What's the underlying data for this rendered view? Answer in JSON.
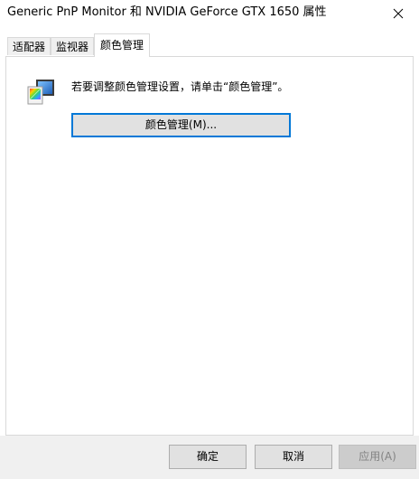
{
  "window": {
    "title": "Generic PnP Monitor 和 NVIDIA GeForce GTX 1650 属性"
  },
  "tabs": [
    {
      "label": "适配器",
      "active": false
    },
    {
      "label": "监视器",
      "active": false
    },
    {
      "label": "颜色管理",
      "active": true
    }
  ],
  "color_management": {
    "instruction": "若要调整颜色管理设置，请单击“颜色管理”。",
    "button_label": "颜色管理(M)...",
    "icon": "monitor-color-icon"
  },
  "footer": {
    "ok_label": "确定",
    "cancel_label": "取消",
    "apply_label": "应用(A)",
    "apply_enabled": false
  },
  "colors": {
    "focus_border": "#0078d7",
    "button_face": "#e1e1e1",
    "footer_bg": "#f0f0f0"
  }
}
